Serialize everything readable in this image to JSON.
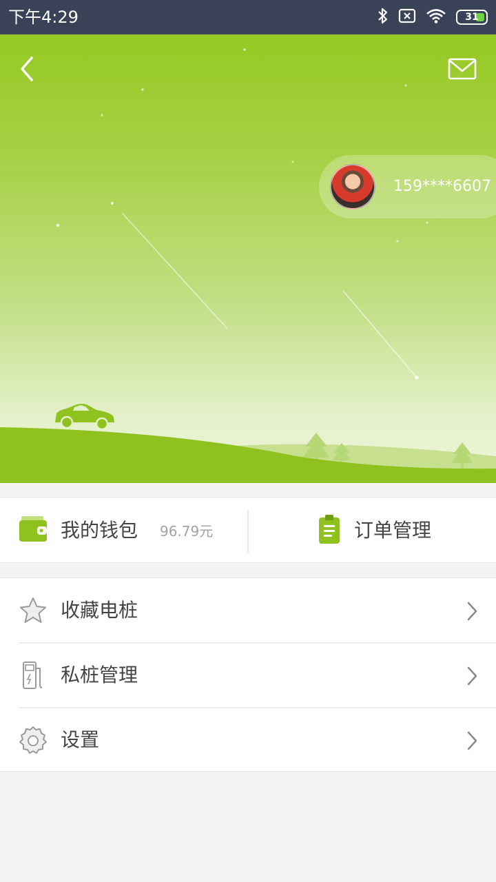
{
  "status_bar": {
    "time": "下午4:29",
    "battery": "31",
    "icons": [
      "bluetooth-icon",
      "no-sim-icon",
      "wifi-icon",
      "battery-icon"
    ]
  },
  "header": {
    "back_icon": "chevron-left-icon",
    "message_icon": "mail-icon"
  },
  "profile": {
    "phone": "159****6607"
  },
  "quick_actions": {
    "wallet_label": "我的钱包",
    "wallet_amount": "96.79元",
    "orders_label": "订单管理"
  },
  "menu": {
    "items": [
      {
        "label": "收藏电桩",
        "icon": "star-icon"
      },
      {
        "label": "私桩管理",
        "icon": "charger-icon"
      },
      {
        "label": "设置",
        "icon": "gear-icon"
      }
    ]
  },
  "colors": {
    "brand_green": "#95c922",
    "status_bar": "#3a4257",
    "text_primary": "#444444",
    "text_secondary": "#a2a2a2"
  }
}
